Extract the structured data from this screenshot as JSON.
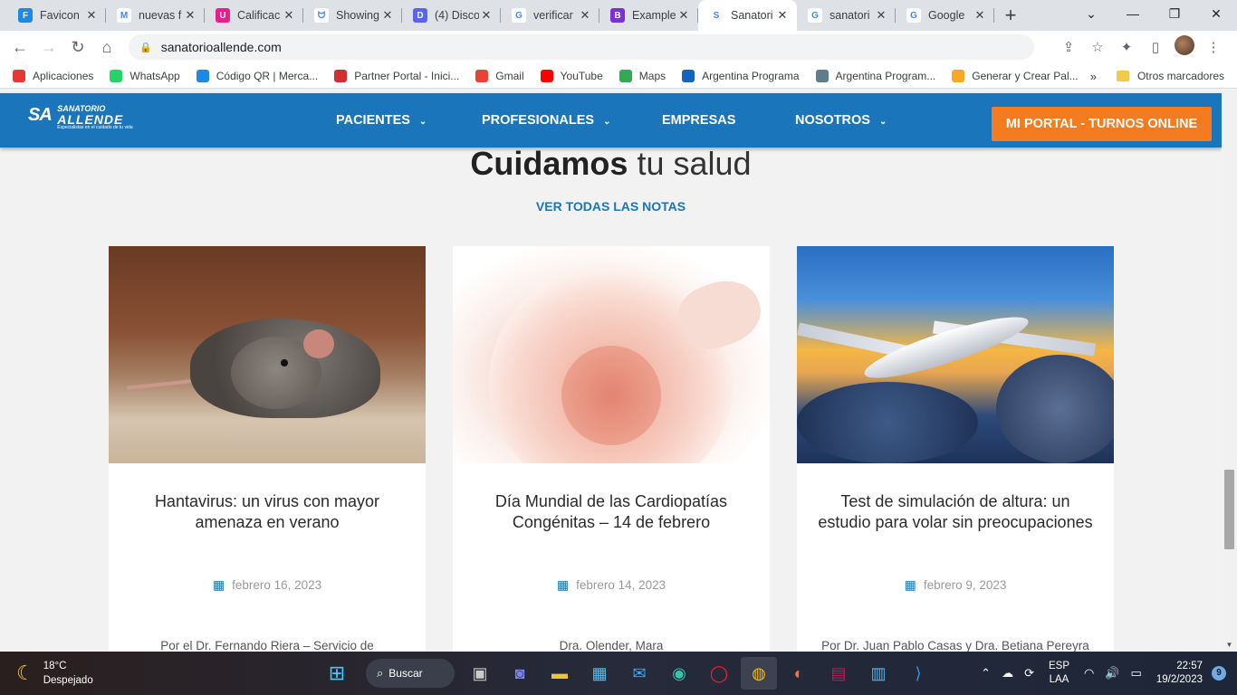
{
  "browser": {
    "tabs": [
      {
        "title": "Favicon",
        "fav_color": "#1e88e5",
        "fav_letter": "F",
        "icon": "favicon-io-icon"
      },
      {
        "title": "nuevas f",
        "fav_color": "#ffffff",
        "fav_letter": "M",
        "icon": "gmail-icon"
      },
      {
        "title": "Calificac",
        "fav_color": "#e91e8c",
        "fav_letter": "U",
        "icon": "udemy-icon"
      },
      {
        "title": "Showing",
        "fav_color": "#ffffff",
        "fav_letter": "ᗢ",
        "icon": "github-icon"
      },
      {
        "title": "(4) Disco",
        "fav_color": "#5865f2",
        "fav_letter": "D",
        "icon": "discord-icon"
      },
      {
        "title": "verificar",
        "fav_color": "#ffffff",
        "fav_letter": "G",
        "icon": "google-icon"
      },
      {
        "title": "Example",
        "fav_color": "#7b2fd6",
        "fav_letter": "B",
        "icon": "bootstrap-icon"
      },
      {
        "title": "Sanatori",
        "fav_color": "#ffffff",
        "fav_letter": "S",
        "icon": "sanatorio-icon",
        "active": true
      },
      {
        "title": "sanatori",
        "fav_color": "#ffffff",
        "fav_letter": "G",
        "icon": "google-icon"
      },
      {
        "title": "Google",
        "fav_color": "#ffffff",
        "fav_letter": "G",
        "icon": "google-icon"
      }
    ],
    "new_tab": "+",
    "url": "sanatorioallende.com",
    "bookmarks": [
      {
        "label": "Aplicaciones",
        "color": "#e53935",
        "icon": "apps-grid-icon"
      },
      {
        "label": "WhatsApp",
        "color": "#25d366",
        "icon": "whatsapp-icon"
      },
      {
        "label": "Código QR | Merca...",
        "color": "#1e88e5",
        "icon": "mercadopago-icon"
      },
      {
        "label": "Partner Portal - Inici...",
        "color": "#d32f2f",
        "icon": "partner-portal-icon"
      },
      {
        "label": "Gmail",
        "color": "#ea4335",
        "icon": "gmail-icon"
      },
      {
        "label": "YouTube",
        "color": "#ff0000",
        "icon": "youtube-icon"
      },
      {
        "label": "Maps",
        "color": "#34a853",
        "icon": "maps-pin-icon"
      },
      {
        "label": "Argentina Programa",
        "color": "#1565c0",
        "icon": "argentina-programa-icon"
      },
      {
        "label": "Argentina Program...",
        "color": "#607d8b",
        "icon": "argentina-programa-icon"
      },
      {
        "label": "Generar y Crear Pal...",
        "color": "#f9a825",
        "icon": "generator-icon"
      }
    ],
    "bookmarks_more": "»",
    "other_bookmarks": "Otros marcadores"
  },
  "site": {
    "logo_mark": "SA",
    "logo_line1": "SANATORIO",
    "logo_line2": "ALLENDE",
    "logo_tagline": "Especialistas en el cuidado de tu vida",
    "menu": [
      {
        "label": "PACIENTES",
        "has_dropdown": true
      },
      {
        "label": "PROFESIONALES",
        "has_dropdown": true
      },
      {
        "label": "EMPRESAS",
        "has_dropdown": false
      },
      {
        "label": "NOSOTROS",
        "has_dropdown": true
      }
    ],
    "portal_button": "MI PORTAL - TURNOS ONLINE",
    "heading_bold": "Cuidamos",
    "heading_light": "tu salud",
    "see_all": "VER TODAS LAS NOTAS",
    "cards": [
      {
        "title": "Hantavirus: un virus con mayor amenaza en verano",
        "date": "febrero 16, 2023",
        "author": "Por el Dr. Fernando Riera – Servicio de",
        "image": "rat"
      },
      {
        "title": "Día Mundial de las Cardiopatías Congénitas – 14 de febrero",
        "date": "febrero 14, 2023",
        "author": "Dra. Olender, Mara",
        "image": "pregnancy"
      },
      {
        "title": "Test de simulación de altura: un estudio para volar sin preocupaciones",
        "date": "febrero 9, 2023",
        "author": "Por Dr. Juan Pablo Casas y Dra. Betiana Pereyra",
        "image": "airplane"
      }
    ],
    "colors": {
      "brand_blue": "#1b75bb",
      "portal_orange": "#f47b20"
    }
  },
  "taskbar": {
    "weather_temp": "18°C",
    "weather_desc": "Despejado",
    "search_label": "Buscar",
    "lang_line1": "ESP",
    "lang_line2": "LAA",
    "time": "22:57",
    "date": "19/2/2023",
    "notifications": "9"
  }
}
